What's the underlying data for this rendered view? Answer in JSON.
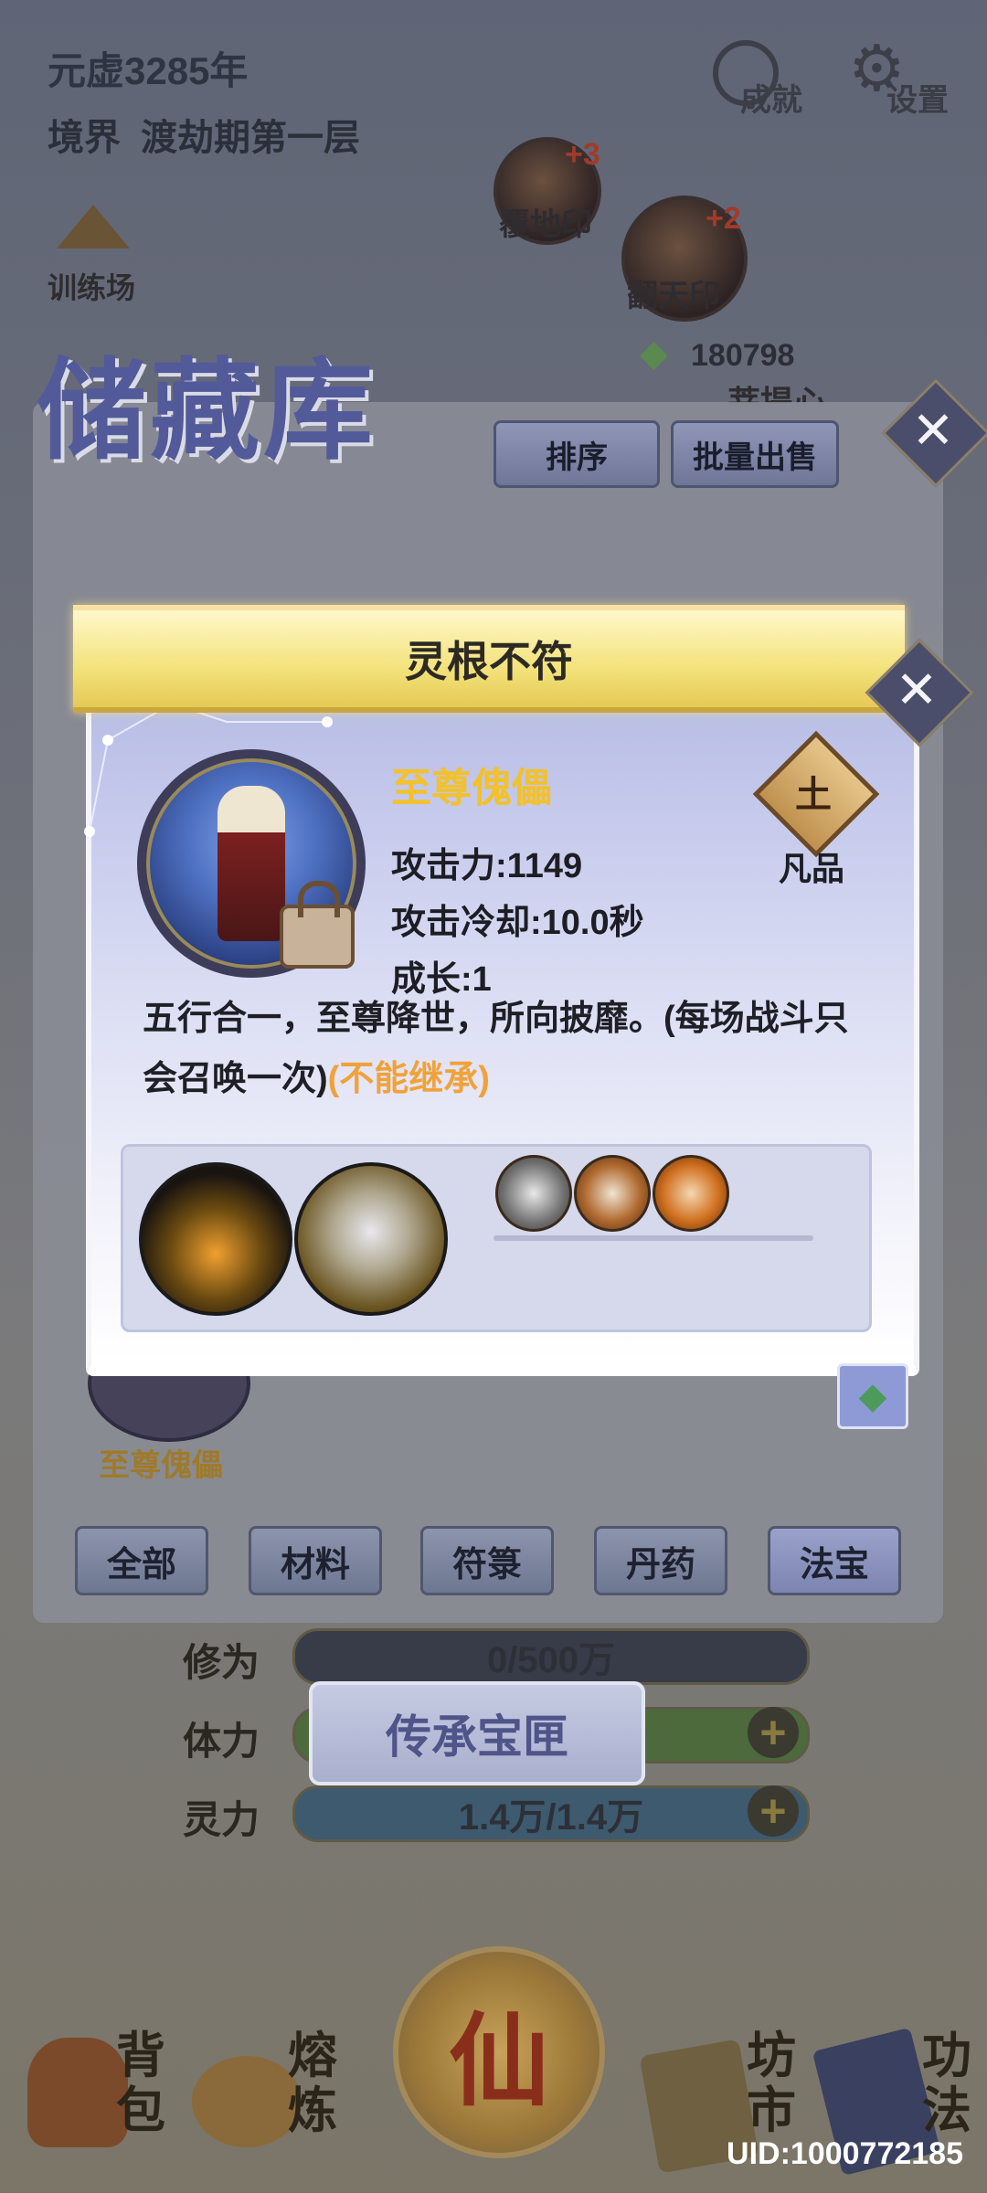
{
  "hud": {
    "year": "元虚3285年",
    "realm_label": "境界",
    "realm_value": "渡劫期第一层",
    "achievements": "成就",
    "settings": "设置",
    "training": "训练场",
    "items": [
      {
        "name": "覆地印",
        "plus": "+3"
      },
      {
        "name": "翻天印",
        "plus": "+2"
      }
    ],
    "jade_count": "180798",
    "partial_label": "菩提心"
  },
  "warehouse": {
    "title": "储藏库",
    "sort_button": "排序",
    "bulk_sell_button": "批量出售",
    "bg_item_label": "至尊傀儡",
    "tabs": [
      "全部",
      "材料",
      "符箓",
      "丹药",
      "法宝"
    ]
  },
  "stats": [
    {
      "label": "修为",
      "value": "0/500万"
    },
    {
      "label": "体力",
      "value": ""
    },
    {
      "label": "灵力",
      "value": "1.4万/1.4万"
    }
  ],
  "inherit_button": "传承宝匣",
  "nav": [
    {
      "label": "背包",
      "icon": "bag-icon"
    },
    {
      "label": "熔炼",
      "icon": "smelt-icon"
    },
    {
      "label": "仙",
      "icon": "immortal-icon"
    },
    {
      "label": "坊市",
      "icon": "market-icon"
    },
    {
      "label": "功法",
      "icon": "book-icon"
    }
  ],
  "uid": "UID:1000772185",
  "dialog": {
    "title": "灵根不符",
    "item_name": "至尊傀儡",
    "attack": "攻击力:1149",
    "cooldown": "攻击冷却:10.0秒",
    "growth": "成长:1",
    "element_glyph": "土",
    "grade": "凡品",
    "description": "五行合一，至尊降世，所向披靡。(每场战斗只会召唤一次)",
    "warning": "(不能继承)"
  },
  "colors": {
    "banner": "#f3e27b",
    "item_name": "#f2c12b",
    "warning": "#f0a23a"
  }
}
